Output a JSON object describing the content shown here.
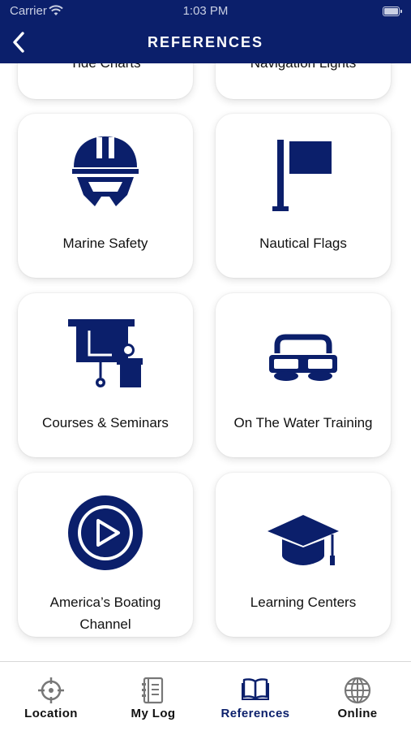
{
  "status_bar": {
    "carrier": "Carrier",
    "time": "1:03 PM"
  },
  "header": {
    "title": "REFERENCES",
    "back_icon": "chevron-left-icon"
  },
  "colors": {
    "brand_navy": "#0b1f6b",
    "card_bg": "#ffffff",
    "tab_active": "#0b1f6b"
  },
  "cards": [
    {
      "label": "Tide Charts",
      "icon": "tide-charts-icon"
    },
    {
      "label": "Navigation Lights",
      "icon": "navigation-lights-icon"
    },
    {
      "label": "Marine Safety",
      "icon": "helmet-icon"
    },
    {
      "label": "Nautical Flags",
      "icon": "flag-icon"
    },
    {
      "label": "Courses & Seminars",
      "icon": "lecture-icon"
    },
    {
      "label": "On The Water Training",
      "icon": "goggles-icon"
    },
    {
      "label": "America’s Boating Channel",
      "icon": "play-icon"
    },
    {
      "label": "Learning Centers",
      "icon": "graduation-cap-icon"
    }
  ],
  "tabs": [
    {
      "label": "Location",
      "icon": "crosshair-icon",
      "active": false
    },
    {
      "label": "My Log",
      "icon": "notebook-icon",
      "active": false
    },
    {
      "label": "References",
      "icon": "book-icon",
      "active": true
    },
    {
      "label": "Online",
      "icon": "globe-icon",
      "active": false
    }
  ]
}
